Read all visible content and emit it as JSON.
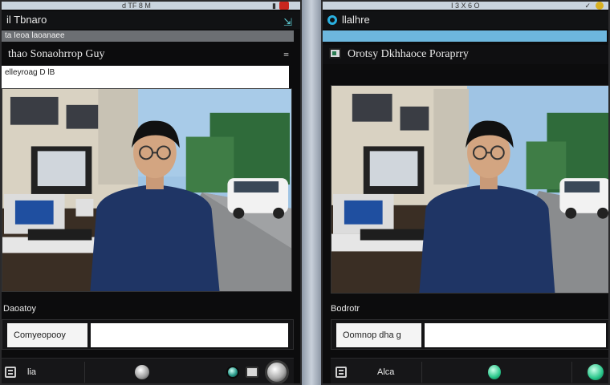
{
  "left": {
    "topbar_text": "d TF 8 M",
    "title": "il Tbnaro",
    "subbar": "ta Ieoa laoanaee",
    "header": "thao Sonaohrrop Guy",
    "url": "elleyroag D lB",
    "section_label": "Daoatoy",
    "input_label": "Comyeopooy",
    "input_value": "",
    "bottom_label": "lia"
  },
  "right": {
    "topbar_text": "I 3 X 6 O",
    "title": "llalhre",
    "subbar": "",
    "header": "Orotsy Dkhhaoce Poraprry",
    "section_label": "Bodrotr",
    "input_label": "Oomnop dha g",
    "input_value": "",
    "bottom_label": "Alca"
  },
  "colors": {
    "panel_bg": "#0c0c0d",
    "accent_blue": "#6db7de",
    "green_button": "#28c68a"
  },
  "icons": [
    "ring-icon",
    "doc-icon",
    "list-icon",
    "knob-icon",
    "menu-icon"
  ]
}
